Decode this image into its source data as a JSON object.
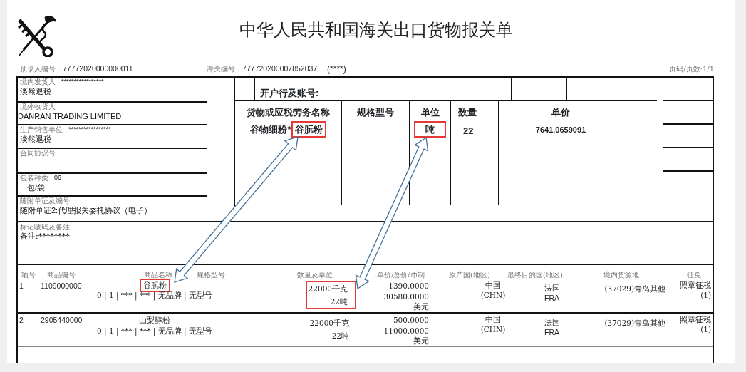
{
  "title": "中华人民共和国海关出口货物报关单",
  "header": {
    "preentry_label": "预录入编号：",
    "preentry_no": "77772020000000011",
    "customs_label": "海关编号：",
    "customs_no": "777720200007852037",
    "mark": "(****)",
    "page": "页码/页数:1/1"
  },
  "sections": [
    {
      "label": "境内发货人",
      "code": "*****************",
      "value": "淡然退税"
    },
    {
      "label": "境外收货人",
      "value": "DANRAN TRADING LIMITED"
    },
    {
      "label": "生产销售单位",
      "code": "*****************",
      "value": "淡然退税"
    },
    {
      "label": "合同协议号"
    },
    {
      "label": "包装种类",
      "code": "06",
      "value": "包/袋"
    },
    {
      "label": "随附单证及编号",
      "value": "随附单证2:代理报关委托协议（电子）"
    }
  ],
  "remarks": {
    "label": "标记唛码及备注",
    "value": "备注:********"
  },
  "invoice": {
    "bank_label": "开户行及账号:",
    "columns": [
      "货物或应税劳务名称",
      "规格型号",
      "单位",
      "数量",
      "单价"
    ],
    "item": {
      "name_prefix": "谷物细粉*",
      "name": "谷朊粉",
      "name_highlighted": true,
      "unit": "吨",
      "unit_highlighted": true,
      "quantity": "22",
      "price": "7641.0659091"
    }
  },
  "goods": {
    "columns": [
      "项号",
      "商品编号",
      "商品名称",
      "规格型号",
      "数量及单位",
      "单价/总价/币制",
      "原产国(地区)",
      "最终目的国(地区)",
      "境内货源地",
      "征免"
    ],
    "rows": [
      {
        "no": "1",
        "code": "1109000000",
        "name": "谷朊粉",
        "name_highlighted": true,
        "spec": "0 | 1 | *** | *** | 无品牌 | 无型号",
        "qty_weight": "22000千克",
        "qty_unit": "22吨",
        "qty_highlighted": true,
        "price": "1390.0000",
        "total": "30580.0000",
        "currency": "美元",
        "origin": "中国",
        "origin_code": "(CHN)",
        "dest": "法国",
        "dest_code": "FRA",
        "source": "(37029)青岛其他",
        "levy": "照章征税",
        "levy_code": "(1)"
      },
      {
        "no": "2",
        "code": "2905440000",
        "name": "山梨醇粉",
        "name_highlighted": false,
        "spec": "0 | 1 | *** | *** | 无品牌 | 无型号",
        "qty_weight": "22000千克",
        "qty_unit": "22吨",
        "qty_highlighted": false,
        "price": "500.0000",
        "total": "11000.0000",
        "currency": "美元",
        "origin": "中国",
        "origin_code": "(CHN)",
        "dest": "法国",
        "dest_code": "FRA",
        "source": "(37029)青岛其他",
        "levy": "照章征税",
        "levy_code": "(1)"
      }
    ]
  }
}
